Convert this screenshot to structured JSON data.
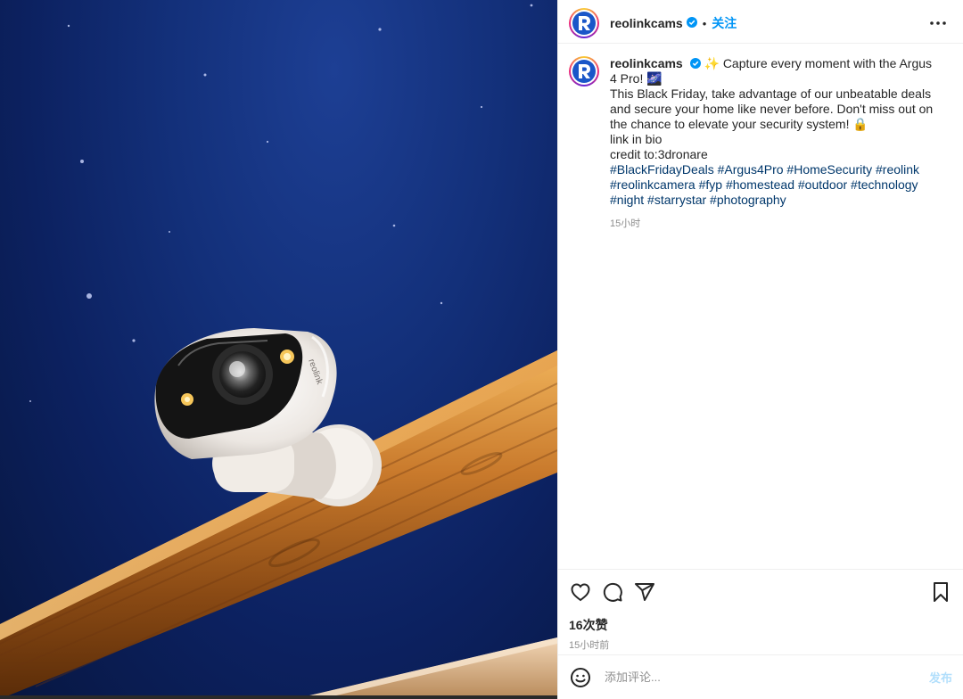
{
  "media": {
    "description_label": "",
    "camera_brand_text": "reolink"
  },
  "header": {
    "username": "reolinkcams",
    "separator": "•",
    "follow_label": "关注",
    "more_icon": "more-horizontal-icon"
  },
  "caption": {
    "username": "reolinkcams",
    "line1": "✨ Capture every moment with the Argus 4 Pro! 🌌",
    "line2": "This Black Friday, take advantage of our unbeatable deals and secure your home like never before. Don't miss out on the chance to elevate your security system! 🔒",
    "line3": "link in bio",
    "line4": "credit to:3dronare",
    "hashtags": "#BlackFridayDeals #Argus4Pro #HomeSecurity #reolink #reolinkcamera #fyp #homestead #outdoor #technology #night #starrystar #photography",
    "time": "15小时"
  },
  "actions": {
    "like_icon": "heart-icon",
    "comment_icon": "comment-icon",
    "share_icon": "share-icon",
    "save_icon": "bookmark-icon",
    "likes": "16次赞",
    "posted": "15小时前"
  },
  "comment": {
    "placeholder": "添加评论...",
    "publish_label": "发布",
    "emoji_icon": "emoji-icon"
  },
  "colors": {
    "accent": "#0095f6",
    "hashtag": "#00376b",
    "muted": "#8e8e8e",
    "publish_disabled": "#b2dffc",
    "brand_logo": "#1a56c8"
  }
}
